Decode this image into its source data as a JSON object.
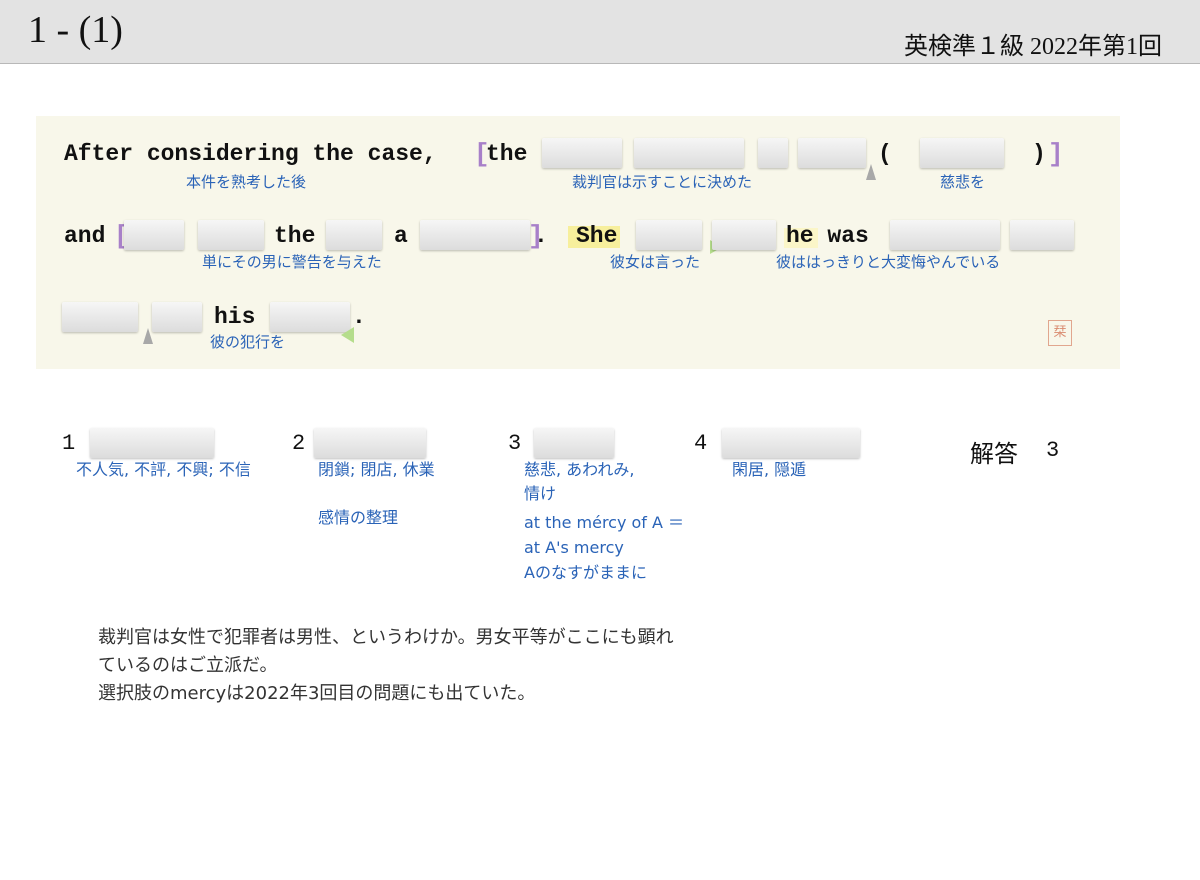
{
  "header": {
    "question_number": "1 - (1)",
    "exam": "英検準１級  2022年第1回"
  },
  "passage": {
    "line1": {
      "w1": "After considering the case,",
      "bracket_open": "[",
      "w2": "the",
      "paren_open": "(",
      "paren_close": ")",
      "bracket_close": "]"
    },
    "line2": {
      "w1": "and",
      "bracket_open": "[",
      "w2": "the",
      "w3": "a",
      "bracket_close": "]",
      "dot": ".",
      "w4": "She",
      "w5": "he was"
    },
    "line3": {
      "w1": "his",
      "dot": "."
    },
    "glosses": {
      "g1": "本件を熟考した後",
      "g2": "裁判官は示すことに決めた",
      "g3": "慈悲を",
      "g4": "単にその男に警告を与えた",
      "g5": "彼女は言った",
      "g6": "彼ははっきりと大変悔やんでいる",
      "g7": "彼の犯行を"
    },
    "seal": "栞"
  },
  "choices": [
    {
      "num": "1",
      "gloss": [
        "不人気, 不評, 不興; 不信"
      ]
    },
    {
      "num": "2",
      "gloss": [
        "閉鎖; 閉店, 休業",
        "",
        "感情の整理"
      ]
    },
    {
      "num": "3",
      "gloss": [
        "慈悲, あわれみ,",
        "情け",
        "at the mércy of A ＝",
        "at A's mercy",
        "Aのなすがままに"
      ]
    },
    {
      "num": "4",
      "gloss": [
        "閑居, 隠遁"
      ]
    }
  ],
  "answer": {
    "label": "解答",
    "value": "3"
  },
  "notes": [
    "裁判官は女性で犯罪者は男性、というわけか。男女平等がここにも顕れ",
    "ているのはご立派だ。",
    "選択肢のmercyは2022年3回目の問題にも出ていた。"
  ]
}
